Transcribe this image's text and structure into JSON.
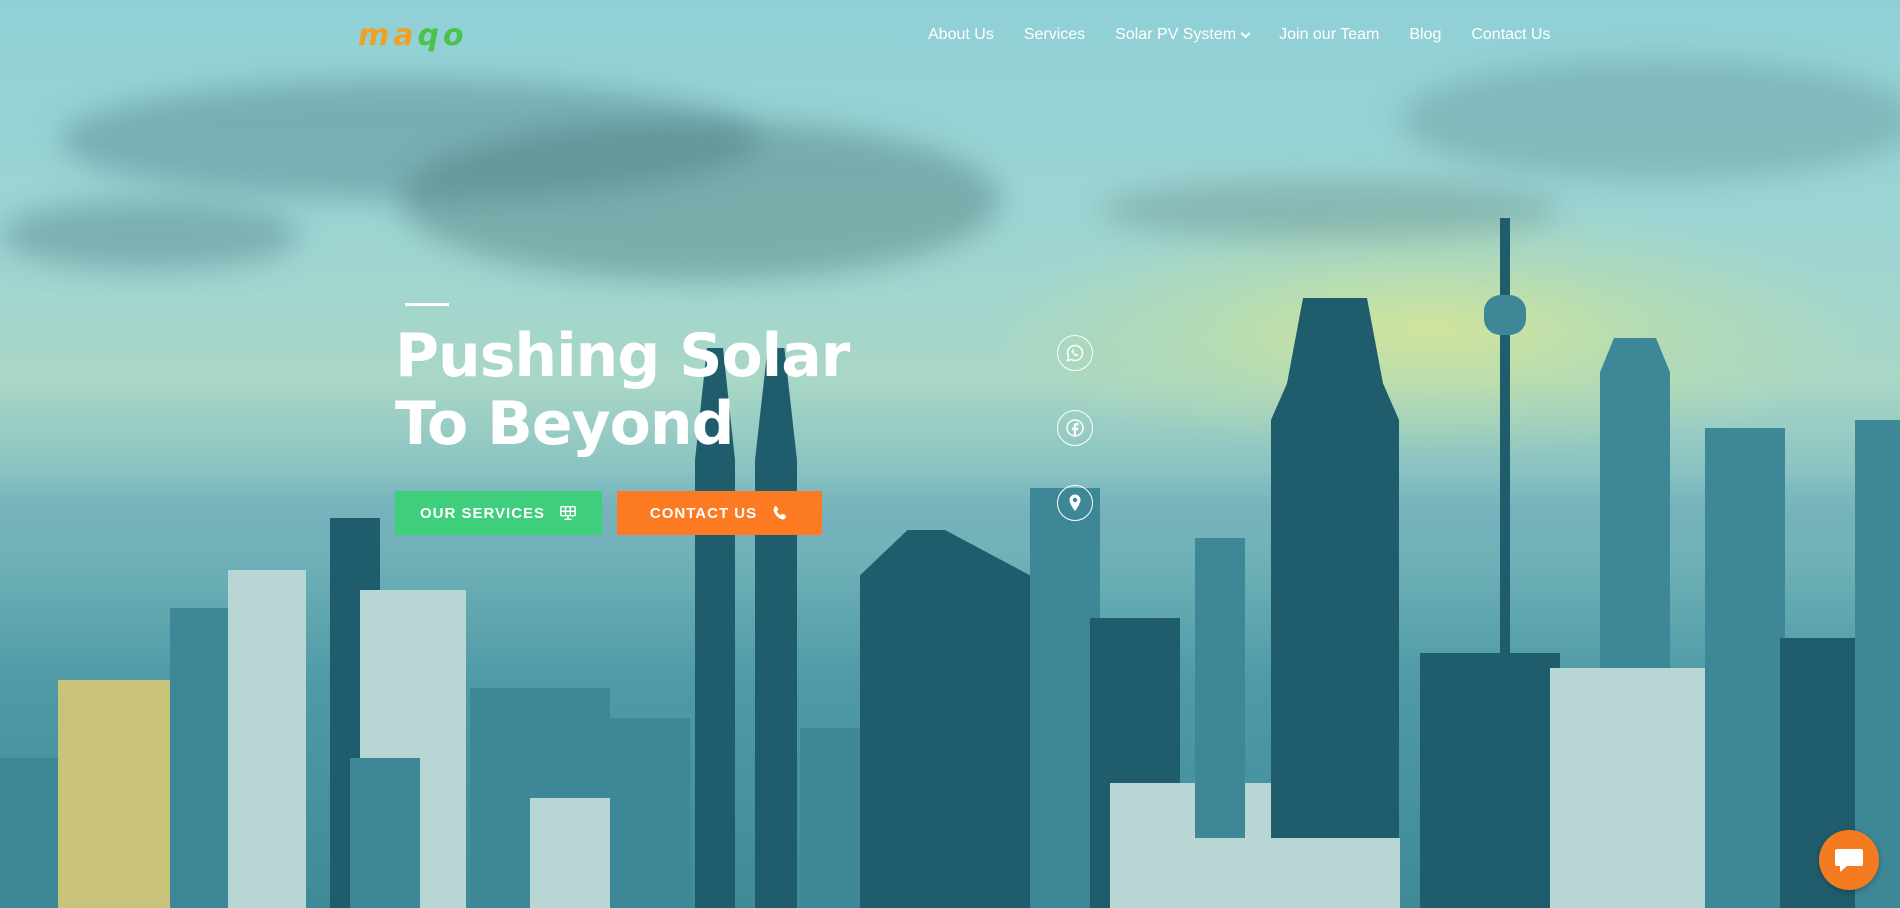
{
  "brand": {
    "logo_part1": "ma",
    "logo_part2": "qo",
    "colors": {
      "orange": "#f0a024",
      "green": "#4cc24a"
    }
  },
  "nav": {
    "items": [
      {
        "label": "About Us"
      },
      {
        "label": "Services"
      },
      {
        "label": "Solar PV System",
        "has_dropdown": true
      },
      {
        "label": "Join our Team"
      },
      {
        "label": "Blog"
      },
      {
        "label": "Contact Us"
      }
    ]
  },
  "hero": {
    "title": "Pushing Solar To Beyond",
    "primary_button": {
      "label": "OUR SERVICES",
      "icon": "solar-panel-icon",
      "color": "#3fce7b"
    },
    "secondary_button": {
      "label": "CONTACT US",
      "icon": "phone-icon",
      "color": "#fc7b22"
    }
  },
  "social": [
    {
      "icon": "whatsapp-icon"
    },
    {
      "icon": "facebook-icon"
    },
    {
      "icon": "map-pin-icon"
    }
  ],
  "chat": {
    "icon": "chat-icon",
    "color": "#f47b20"
  }
}
